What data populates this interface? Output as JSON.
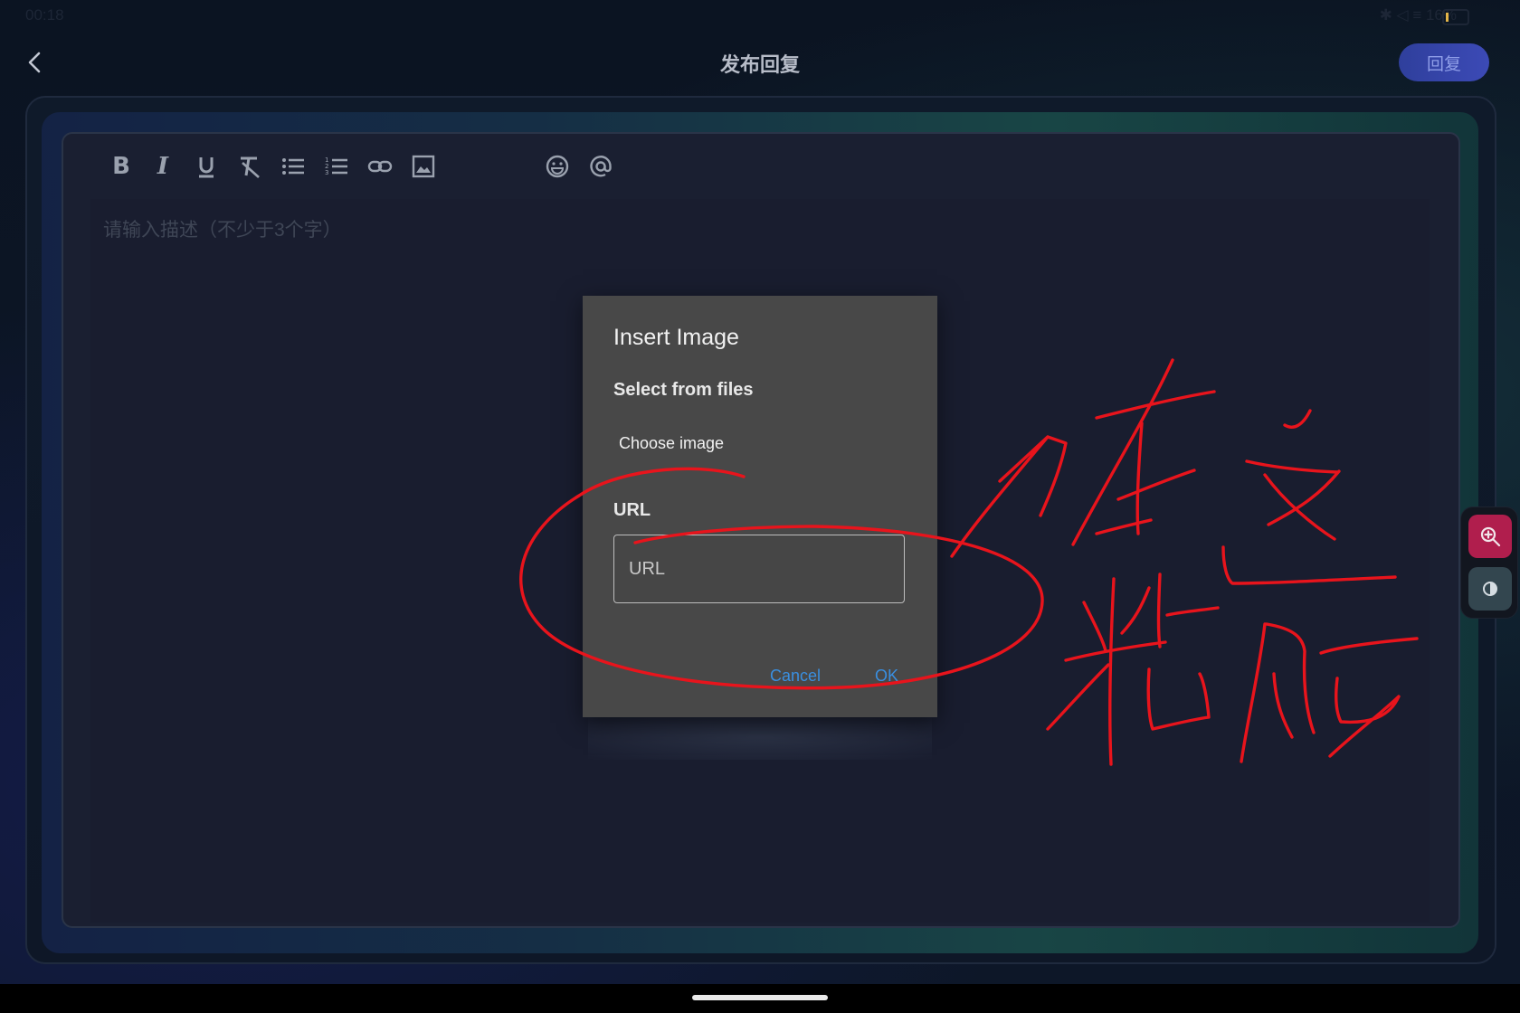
{
  "status_bar": {
    "time": "00:18",
    "right_text": "✱ ◁ ≡ 16%"
  },
  "header": {
    "title": "发布回复",
    "reply_label": "回复"
  },
  "editor": {
    "placeholder": "请输入描述（不少于3个字）",
    "toolbar": [
      "bold-icon",
      "italic-icon",
      "underline-icon",
      "clear-format-icon",
      "bullet-list-icon",
      "numbered-list-icon",
      "link-icon",
      "image-icon",
      "emoji-icon",
      "mention-icon"
    ]
  },
  "dialog": {
    "title": "Insert Image",
    "subtitle": "Select from files",
    "choose_label": "Choose image",
    "url_label": "URL",
    "url_placeholder": "URL",
    "url_value": "",
    "cancel_label": "Cancel",
    "ok_label": "OK"
  },
  "side_tools": [
    "zoom-in-icon",
    "contrast-icon"
  ],
  "annotation": {
    "color": "#e8141c",
    "text": "在这粘贴"
  },
  "colors": {
    "accent": "#3a8fe0",
    "reply_button": "#3c4ab6",
    "zoom_button": "#b01e4d"
  }
}
